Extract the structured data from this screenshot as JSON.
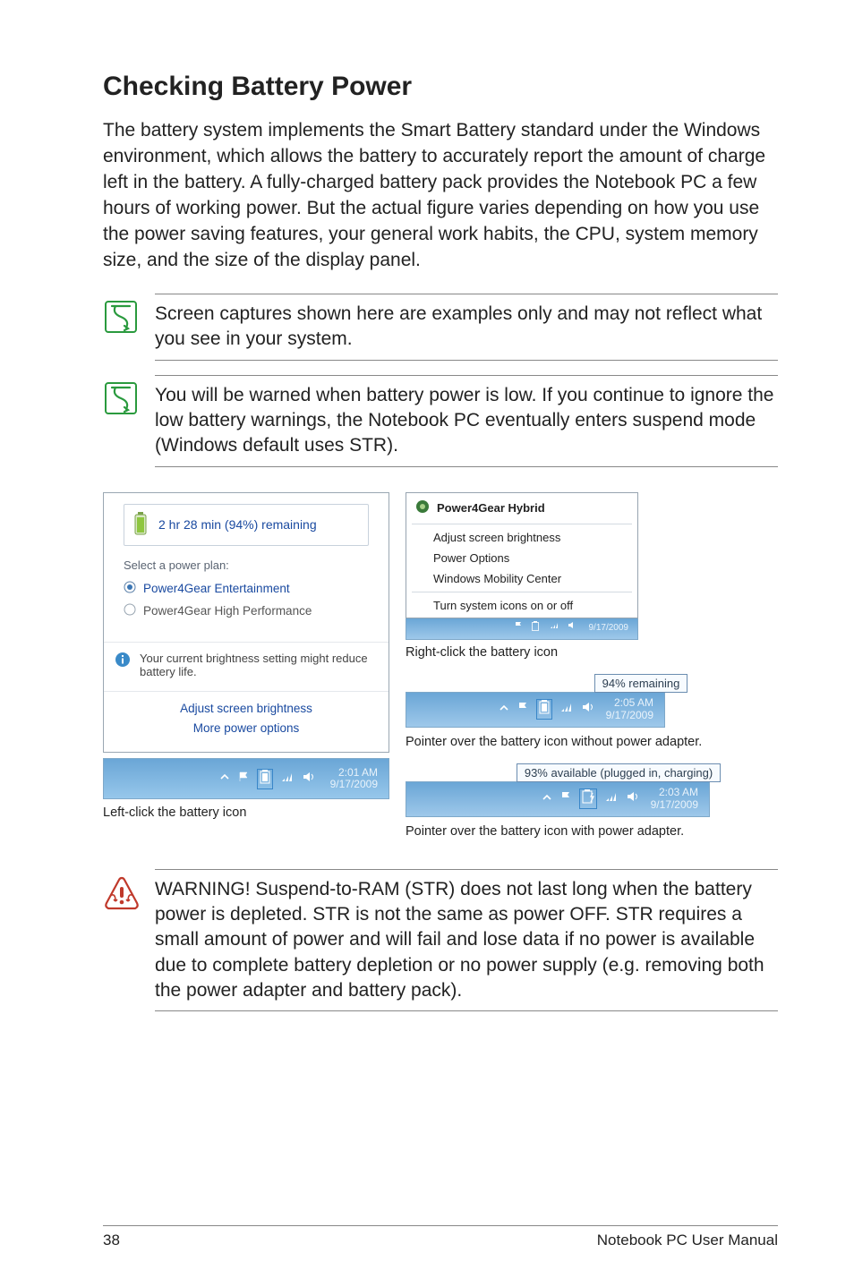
{
  "heading": "Checking Battery Power",
  "intro": "The battery system implements the Smart Battery standard under the Windows environment, which allows the battery to accurately report the amount of charge left in the battery. A fully-charged battery pack provides the Notebook PC a few hours of working power. But the actual figure varies depending on how you use the power saving features, your general work habits, the CPU, system memory size, and the size of the display panel.",
  "note1": "Screen captures shown here are examples only and may not reflect what you see in your system.",
  "note2": "You will be warned when battery power is low. If you continue to ignore the low battery warnings, the Notebook PC eventually enters suspend mode (Windows default uses STR).",
  "warning": "WARNING!  Suspend-to-RAM (STR) does not last long when the battery power is depleted. STR is not the same as power OFF. STR requires a small amount of power and will fail and lose data if no power is available due to complete battery depletion or no power supply (e.g. removing both the power adapter and battery pack).",
  "battery_panel": {
    "remaining": "2 hr 28 min (94%) remaining",
    "select_label": "Select a power plan:",
    "plan1": "Power4Gear Entertainment",
    "plan2": "Power4Gear High Performance",
    "info": "Your current brightness setting might reduce battery life.",
    "link1": "Adjust screen brightness",
    "link2": "More power options",
    "time": "2:01 AM",
    "date": "9/17/2009"
  },
  "caption_left": "Left-click the battery icon",
  "context_menu": {
    "header": "Power4Gear Hybrid",
    "item1": "Adjust screen brightness",
    "item2": "Power Options",
    "item3": "Windows Mobility Center",
    "item4": "Turn system icons on or off",
    "date": "9/17/2009"
  },
  "caption_ctx": "Right-click the battery icon",
  "tooltip1": "94% remaining",
  "tooltip1_time": "2:05 AM",
  "tooltip1_date": "9/17/2009",
  "caption_tt1": "Pointer over the battery icon without power adapter.",
  "tooltip2": "93% available (plugged in, charging)",
  "tooltip2_time": "2:03 AM",
  "tooltip2_date": "9/17/2009",
  "caption_tt2": "Pointer over the battery icon with power adapter.",
  "footer": {
    "page": "38",
    "title": "Notebook PC User Manual"
  }
}
